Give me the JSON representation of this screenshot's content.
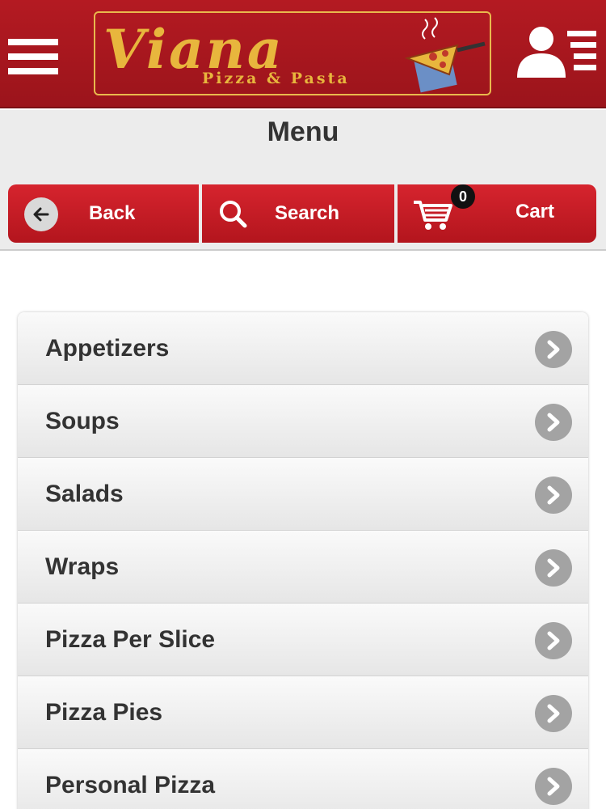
{
  "header": {
    "brand_name": "Viana",
    "brand_tagline": "Pizza & Pasta"
  },
  "page": {
    "title": "Menu"
  },
  "nav": {
    "back_label": "Back",
    "search_label": "Search",
    "cart_label": "Cart",
    "cart_count": "0"
  },
  "menu": {
    "categories": [
      {
        "label": "Appetizers"
      },
      {
        "label": "Soups"
      },
      {
        "label": "Salads"
      },
      {
        "label": "Wraps"
      },
      {
        "label": "Pizza Per Slice"
      },
      {
        "label": "Pizza Pies"
      },
      {
        "label": "Personal Pizza"
      }
    ]
  },
  "icons": {
    "menu": "hamburger-icon",
    "account": "user-list-icon",
    "back": "arrow-left-icon",
    "search": "search-icon",
    "cart": "cart-icon",
    "item": "chevron-right-icon"
  },
  "colors": {
    "brand_red": "#b41a22",
    "logo_gold": "#e8b63d",
    "button_red": "#d6242e",
    "chevron_gray": "#a3a3a3"
  }
}
